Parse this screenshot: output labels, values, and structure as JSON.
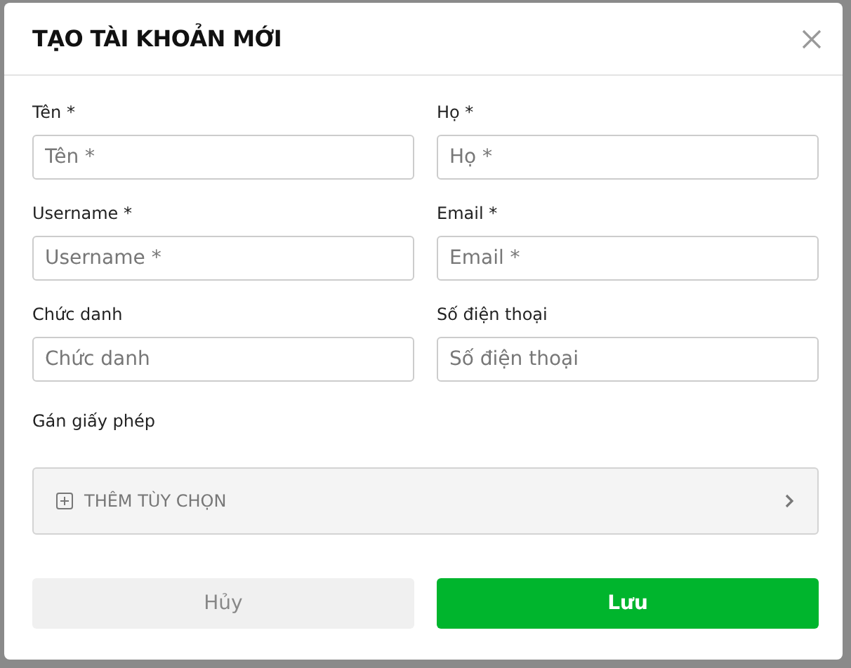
{
  "dialog": {
    "title": "TẠO TÀI KHOẢN MỚI"
  },
  "fields": [
    {
      "label": "Tên *",
      "placeholder": "Tên *"
    },
    {
      "label": "Họ *",
      "placeholder": "Họ *"
    },
    {
      "label": "Username *",
      "placeholder": "Username *"
    },
    {
      "label": "Email *",
      "placeholder": "Email *"
    },
    {
      "label": "Chức danh",
      "placeholder": "Chức danh"
    },
    {
      "label": "Số điện thoại",
      "placeholder": "Số điện thoại"
    }
  ],
  "license": {
    "label": "Gán giấy phép",
    "option": "THÊM TÙY CHỌN"
  },
  "buttons": [
    {
      "label": "Hủy",
      "kind": "secondary"
    },
    {
      "label": "Lưu",
      "kind": "primary"
    }
  ]
}
